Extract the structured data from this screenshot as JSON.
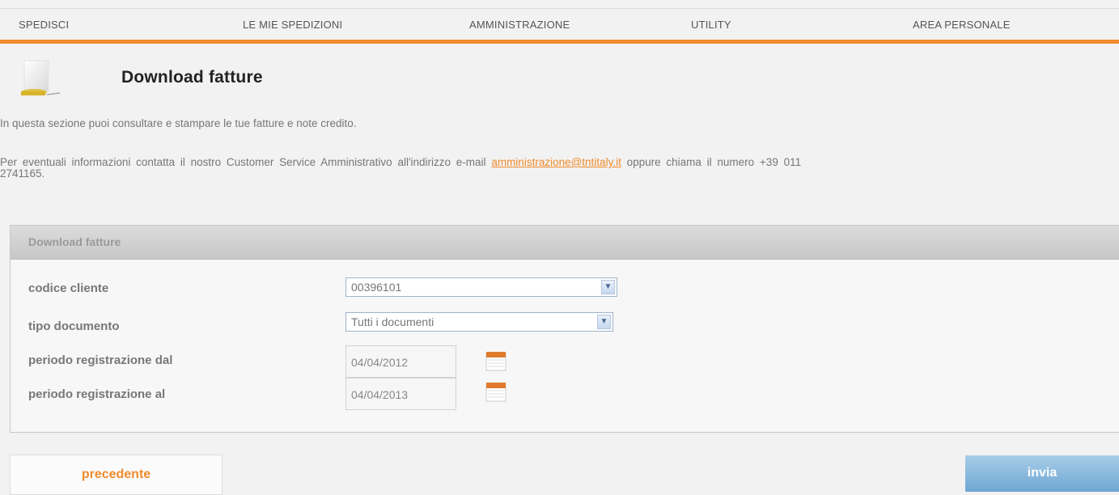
{
  "nav": {
    "items": [
      {
        "label": "SPEDISCI"
      },
      {
        "label": "LE MIE SPEDIZIONI"
      },
      {
        "label": "AMMINISTRAZIONE"
      },
      {
        "label": "UTILITY"
      },
      {
        "label": "AREA PERSONALE"
      }
    ]
  },
  "page": {
    "icon": "document-icon",
    "title": "Download fatture",
    "intro": "In questa sezione puoi consultare e stampare le tue fatture e note credito.",
    "info_before": "Per eventuali informazioni contatta il nostro Customer Service Amministrativo all'indirizzo e-mail",
    "info_email": "amministrazione@tntitaly.it",
    "info_after": "oppure chiama il numero +39 011",
    "info_line2": "2741165."
  },
  "panel": {
    "title": "Download fatture",
    "fields": {
      "codice_cliente": {
        "label": "codice cliente",
        "value": "00396101"
      },
      "tipo_documento": {
        "label": "tipo documento",
        "value": "Tutti i documenti"
      },
      "periodo_dal": {
        "label": "periodo registrazione dal",
        "value": "04/04/2012"
      },
      "periodo_al": {
        "label": "periodo registrazione al",
        "value": "04/04/2013"
      }
    }
  },
  "buttons": {
    "previous": "precedente",
    "submit": "invia"
  },
  "colors": {
    "accent": "#ef8b2c",
    "submit": "#6fa7d3",
    "background": "#f2f2f2"
  }
}
